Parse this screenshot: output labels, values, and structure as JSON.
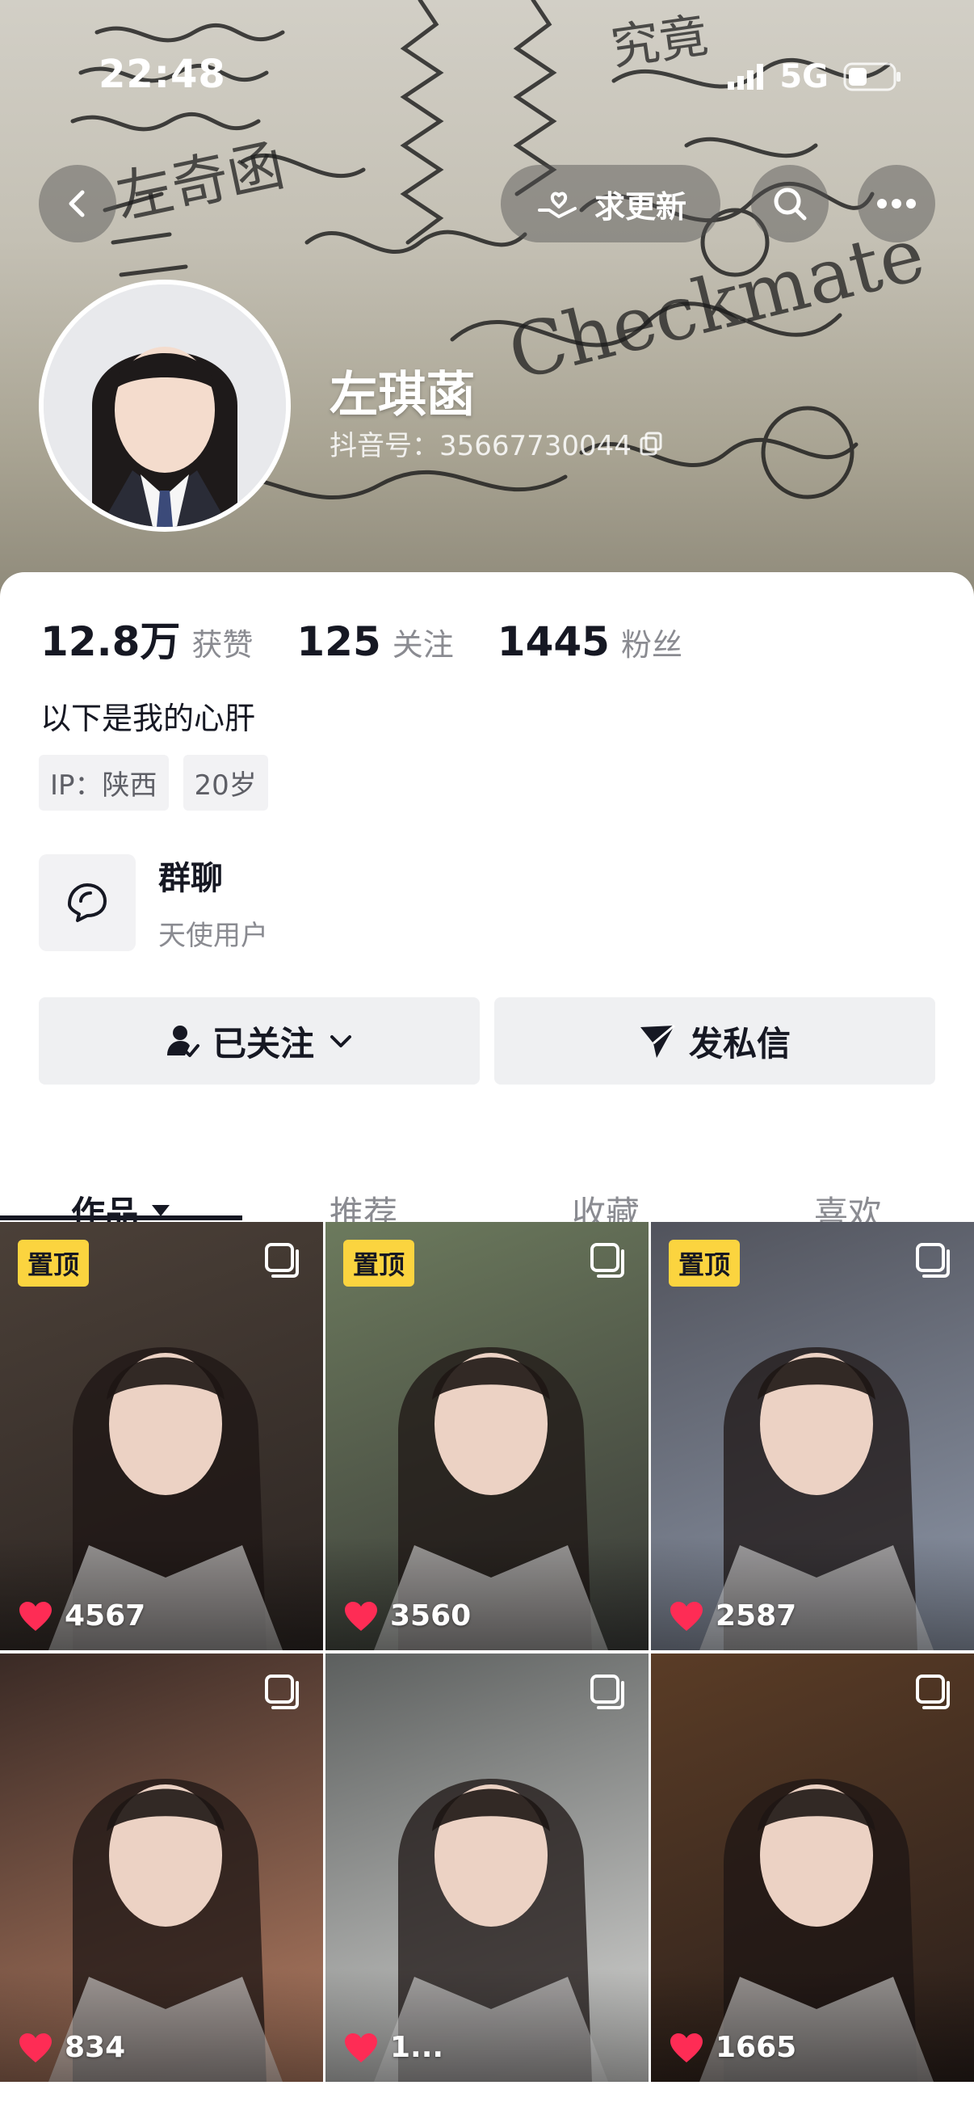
{
  "status_bar": {
    "time": "22:48",
    "network": "5G"
  },
  "header": {
    "request_update_label": "求更新",
    "banner_text": "Checkmate"
  },
  "profile": {
    "name": "左琪菡",
    "id_label": "抖音号：35667730044"
  },
  "stats": [
    {
      "value": "12.8万",
      "label": "获赞"
    },
    {
      "value": "125",
      "label": "关注"
    },
    {
      "value": "1445",
      "label": "粉丝"
    }
  ],
  "bio": "以下是我的心肝",
  "tags": [
    "IP：陕西",
    "20岁"
  ],
  "group_chat": {
    "title": "群聊",
    "subtitle": "天使用户"
  },
  "actions": {
    "follow_label": "已关注",
    "message_label": "发私信"
  },
  "tabs": [
    "作品",
    "推荐",
    "收藏",
    "喜欢"
  ],
  "videos": [
    {
      "pinned": true,
      "pin_label": "置顶",
      "likes": "4567",
      "colors": [
        "#4b4038",
        "#2c2522"
      ]
    },
    {
      "pinned": true,
      "pin_label": "置顶",
      "likes": "3560",
      "colors": [
        "#6c7a5d",
        "#3a3b38"
      ]
    },
    {
      "pinned": true,
      "pin_label": "置顶",
      "likes": "2587",
      "colors": [
        "#51535c",
        "#8c95a6"
      ]
    },
    {
      "pinned": false,
      "pin_label": "",
      "likes": "834",
      "colors": [
        "#3a2a25",
        "#b27c62"
      ]
    },
    {
      "pinned": false,
      "pin_label": "",
      "likes": "1...",
      "colors": [
        "#5c5f5e",
        "#d6d6d4"
      ]
    },
    {
      "pinned": false,
      "pin_label": "",
      "likes": "1665",
      "colors": [
        "#5a3c26",
        "#2a1f1b"
      ]
    }
  ],
  "colors": {
    "accent_red": "#fe2c55",
    "pin_yellow": "#fbd43f",
    "text_dark": "#161823",
    "text_gray": "#8a8b91"
  }
}
